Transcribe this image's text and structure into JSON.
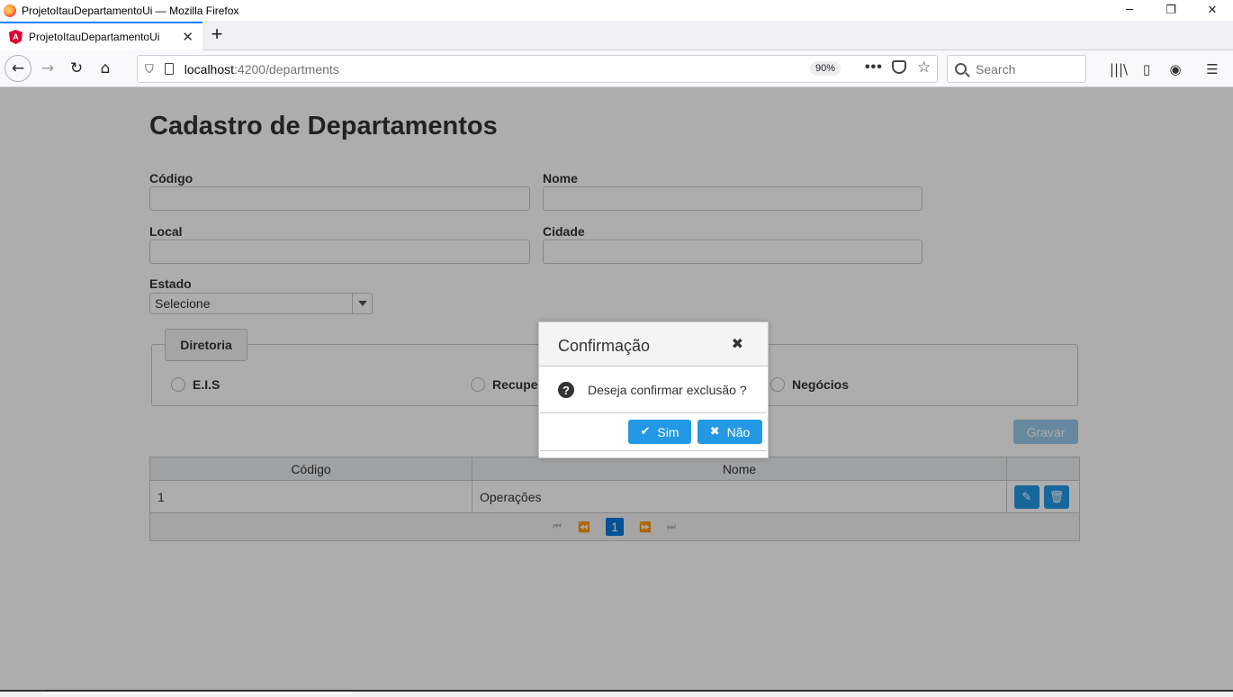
{
  "window": {
    "title": "ProjetoItauDepartamentoUi — Mozilla Firefox",
    "minimize": "─",
    "restore": "❐",
    "close": "✕"
  },
  "tab": {
    "label": "ProjetoItauDepartamentoUi",
    "icon_letter": "A",
    "close": "✕",
    "new_tab": "+"
  },
  "nav": {
    "back": "←",
    "forward": "→",
    "reload": "↻",
    "home": "⌂",
    "url_host": "localhost",
    "url_path": ":4200/departments",
    "zoom": "90%",
    "more": "•••",
    "star": "☆",
    "search_placeholder": "Search",
    "library": "|||\\",
    "sidebar": "▯",
    "account": "◉",
    "menu": "☰"
  },
  "form": {
    "heading": "Cadastro de Departamentos",
    "codigo_label": "Código",
    "nome_label": "Nome",
    "local_label": "Local",
    "cidade_label": "Cidade",
    "estado_label": "Estado",
    "estado_value": "Selecione",
    "diretoria_legend": "Diretoria",
    "radios": [
      "E.I.S",
      "Recupe",
      "Negócios"
    ],
    "save_button": "Gravar"
  },
  "table": {
    "columns": [
      "Código",
      "Nome",
      ""
    ],
    "rows": [
      {
        "codigo": "1",
        "nome": "Operações"
      }
    ],
    "edit_icon": "✎",
    "delete_icon": "🗑",
    "paginator": {
      "first": "⏮",
      "prev": "⏪",
      "current_page": "1",
      "next": "⏩",
      "last": "⏭"
    }
  },
  "dialog": {
    "title": "Confirmação",
    "close": "✖",
    "question_icon": "?",
    "message": "Deseja confirmar exclusão ?",
    "yes_label": "Sim",
    "yes_icon": "✔",
    "no_label": "Não",
    "no_icon": "✖"
  },
  "colors": {
    "primary": "#2399e5",
    "overlay": "rgba(0,0,0,0.32)"
  }
}
